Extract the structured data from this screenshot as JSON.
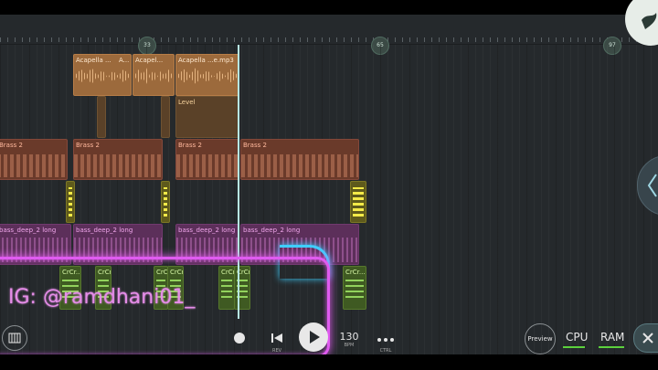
{
  "ruler": {
    "markers": [
      "33",
      "65",
      "97"
    ]
  },
  "clips": {
    "acapella1": "Acapella ...",
    "acapella1b": "A...",
    "acapella2": "Acapel...",
    "acapella3": "Acapella ...e.mp3",
    "level": "Level",
    "brass": "Brass 2",
    "bass": "bass_deep_2 long",
    "drum": "CrCr..."
  },
  "overlay": {
    "watermark": "IG: @ramdhani01_"
  },
  "toolbar": {
    "rev_label": "REV",
    "bpm_value": "130",
    "bpm_label": "BPM",
    "ctrl_label": "CTRL",
    "preview_label": "Preview",
    "cpu_label": "CPU",
    "ram_label": "RAM"
  },
  "colors": {
    "accent_green": "#5cd13c",
    "neon_pink": "#e05bf0",
    "neon_blue": "#3ecfff",
    "playhead": "#b7e6e2"
  },
  "icons": [
    "piano-icon",
    "rewind-icon",
    "play-icon",
    "more-icon",
    "close-icon",
    "chevron-left-icon",
    "fl-logo-icon"
  ]
}
